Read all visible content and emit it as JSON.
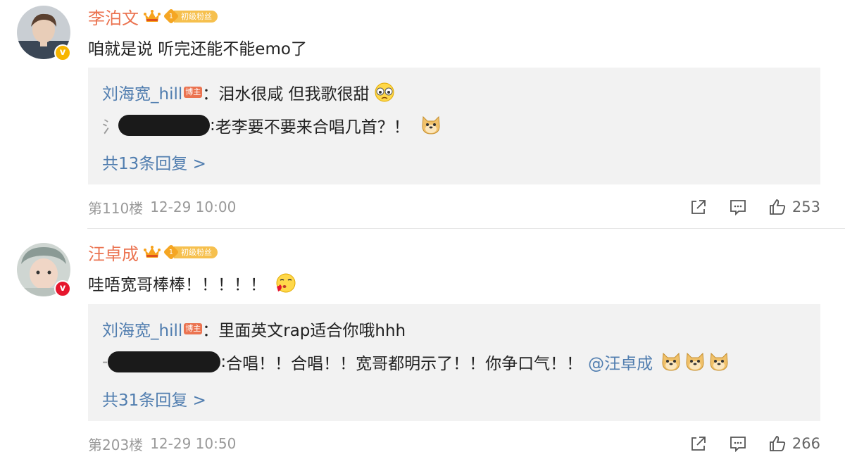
{
  "comments": [
    {
      "user_name": "李泊文",
      "fan_level": "1",
      "fan_badge_text": "初级粉丝",
      "verify_mark": "v",
      "text": "咱就是说 听完还能不能emo了",
      "replies": [
        {
          "user": "刘海宽_hill",
          "tag": "博主",
          "sep": "：",
          "text": "泪水很咸 但我歌很甜",
          "emoji": "tearful-face-emoji"
        },
        {
          "partial_name": "氵",
          "sep": ":",
          "text": "老李要不要来合唱几首？！",
          "emoji": "doge-emoji"
        }
      ],
      "more_replies": "共13条回复 >",
      "floor": "第110楼",
      "time": "12-29 10:00",
      "likes": "253"
    },
    {
      "user_name": "汪卓成",
      "fan_level": "1",
      "fan_badge_text": "初级粉丝",
      "verify_mark": "v",
      "text": "哇唔宽哥棒棒！！！！！",
      "text_emoji": "kiss-face-emoji",
      "replies": [
        {
          "user": "刘海宽_hill",
          "tag": "博主",
          "sep": "：",
          "text": "里面英文rap适合你哦hhh"
        },
        {
          "partial_name": "-",
          "sep": ":",
          "text": "合唱！！合唱！！宽哥都明示了！！你争口气！！",
          "mention": "@汪卓成",
          "emoji": "doge-emoji"
        }
      ],
      "more_replies": "共31条回复 >",
      "floor": "第203楼",
      "time": "12-29 10:50",
      "likes": "266"
    }
  ],
  "colors": {
    "username": "#eb7350",
    "link": "#507daf",
    "reply_bg": "#f2f2f2",
    "meta": "#999999",
    "verified_yellow": "#f7b500",
    "verified_red": "#e6162d"
  }
}
